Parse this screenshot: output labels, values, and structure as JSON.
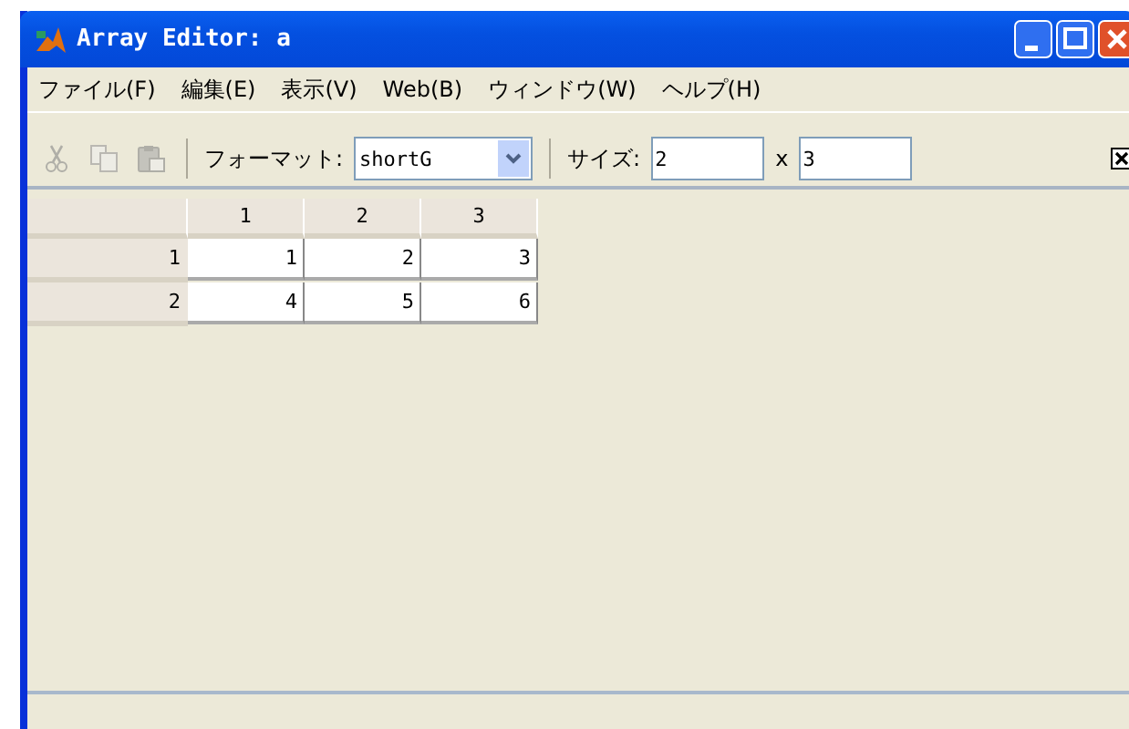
{
  "window": {
    "title": "Array Editor: a"
  },
  "menu": [
    "ファイル(F)",
    "編集(E)",
    "表示(V)",
    "Web(B)",
    "ウィンドウ(W)",
    "ヘルプ(H)"
  ],
  "toolbar": {
    "edit_buttons": [
      {
        "kind": "cut",
        "disabled": true
      },
      {
        "kind": "copy",
        "disabled": true
      },
      {
        "kind": "paste",
        "disabled": true
      }
    ],
    "format_label": "フォーマット:",
    "format_value": "shortG",
    "size_label": "サイズ:",
    "rows_value": "2",
    "times": "x",
    "cols_value": "3"
  },
  "table": {
    "columns": [
      "1",
      "2",
      "3"
    ],
    "rows": [
      {
        "header": "1",
        "cells": [
          "1",
          "2",
          "3"
        ]
      },
      {
        "header": "2",
        "cells": [
          "4",
          "5",
          "6"
        ]
      }
    ]
  }
}
